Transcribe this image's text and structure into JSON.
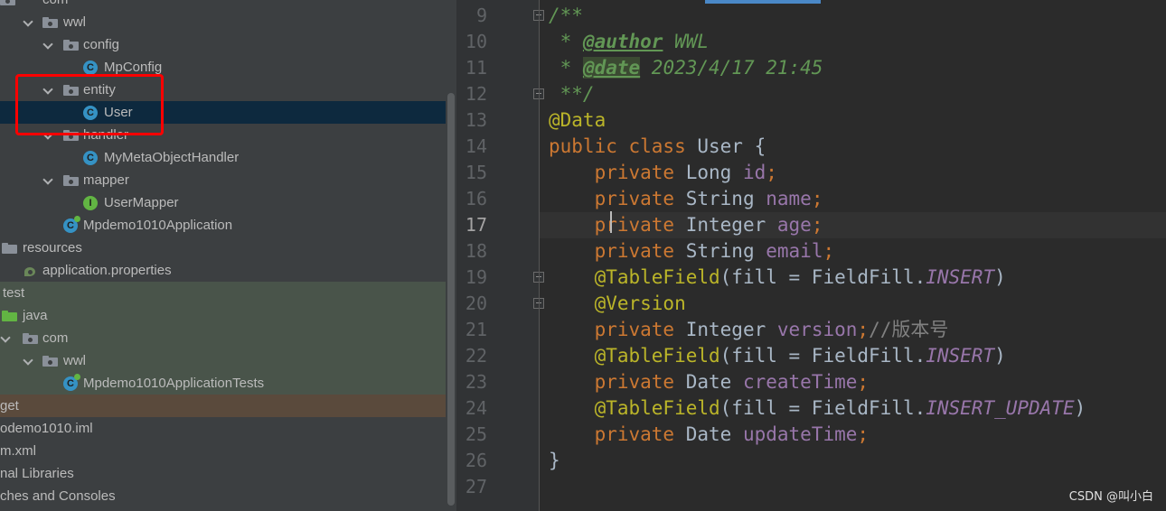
{
  "project_tree": {
    "items": [
      {
        "label": "com",
        "icon": "package-folder-icon",
        "selected": false
      },
      {
        "label": "wwl",
        "icon": "package-folder-icon"
      },
      {
        "label": "config",
        "icon": "package-folder-icon"
      },
      {
        "label": "MpConfig",
        "icon": "class-icon",
        "badge": "C"
      },
      {
        "label": "entity",
        "icon": "package-folder-icon"
      },
      {
        "label": "User",
        "icon": "class-icon",
        "badge": "C",
        "selected": true
      },
      {
        "label": "handler",
        "icon": "package-folder-icon"
      },
      {
        "label": "MyMetaObjectHandler",
        "icon": "class-icon",
        "badge": "C"
      },
      {
        "label": "mapper",
        "icon": "package-folder-icon"
      },
      {
        "label": "UserMapper",
        "icon": "interface-icon",
        "badge": "I"
      },
      {
        "label": "Mpdemo1010Application",
        "icon": "spring-app-icon",
        "badge": "C"
      },
      {
        "label": "resources",
        "icon": "resources-folder-icon"
      },
      {
        "label": "application.properties",
        "icon": "spring-properties-icon"
      },
      {
        "label": "test",
        "icon": "none"
      },
      {
        "label": "java",
        "icon": "test-folder-icon"
      },
      {
        "label": "com",
        "icon": "package-folder-icon"
      },
      {
        "label": "wwl",
        "icon": "package-folder-icon"
      },
      {
        "label": "Mpdemo1010ApplicationTests",
        "icon": "spring-app-icon",
        "badge": "C"
      },
      {
        "label": "get",
        "icon": "none"
      },
      {
        "label": "odemo1010.iml",
        "icon": "none"
      },
      {
        "label": "m.xml",
        "icon": "none"
      },
      {
        "label": "nal Libraries",
        "icon": "none"
      },
      {
        "label": "ches and Consoles",
        "icon": "none"
      }
    ]
  },
  "editor": {
    "current_line": 17,
    "lines": [
      {
        "num": "9",
        "tokens": [
          [
            "doc",
            "/**"
          ]
        ]
      },
      {
        "num": "10",
        "tokens": [
          [
            "doc",
            " * "
          ],
          [
            "doctag",
            "@author"
          ],
          [
            "doc",
            " WWL"
          ]
        ]
      },
      {
        "num": "11",
        "tokens": [
          [
            "doc",
            " * "
          ],
          [
            "docdate",
            "@date"
          ],
          [
            "doc",
            " 2023/4/17 21:45"
          ]
        ]
      },
      {
        "num": "12",
        "tokens": [
          [
            "doc",
            " **/"
          ]
        ]
      },
      {
        "num": "13",
        "tokens": [
          [
            "ann",
            "@Data"
          ]
        ]
      },
      {
        "num": "14",
        "tokens": [
          [
            "kw",
            "public class "
          ],
          [
            "plain",
            "User {"
          ]
        ]
      },
      {
        "num": "15",
        "tokens": [
          [
            "plain",
            "    "
          ],
          [
            "kw",
            "private "
          ],
          [
            "plain",
            "Long "
          ],
          [
            "field",
            "id"
          ],
          [
            "semi",
            ";"
          ]
        ]
      },
      {
        "num": "16",
        "tokens": [
          [
            "plain",
            "    "
          ],
          [
            "kw",
            "private "
          ],
          [
            "plain",
            "String "
          ],
          [
            "field",
            "name"
          ],
          [
            "semi",
            ";"
          ]
        ]
      },
      {
        "num": "17",
        "tokens": [
          [
            "plain",
            "    "
          ],
          [
            "kw",
            "private "
          ],
          [
            "plain",
            "Integer "
          ],
          [
            "field",
            "age"
          ],
          [
            "semi",
            ";"
          ]
        ]
      },
      {
        "num": "18",
        "tokens": [
          [
            "plain",
            "    "
          ],
          [
            "kw",
            "private "
          ],
          [
            "plain",
            "String "
          ],
          [
            "field",
            "email"
          ],
          [
            "semi",
            ";"
          ]
        ]
      },
      {
        "num": "19",
        "tokens": [
          [
            "plain",
            "    "
          ],
          [
            "ann",
            "@TableField"
          ],
          [
            "plain",
            "(fill = FieldFill."
          ],
          [
            "const",
            "INSERT"
          ],
          [
            "plain",
            ")"
          ]
        ]
      },
      {
        "num": "20",
        "tokens": [
          [
            "plain",
            "    "
          ],
          [
            "ann",
            "@Version"
          ]
        ]
      },
      {
        "num": "21",
        "tokens": [
          [
            "plain",
            "    "
          ],
          [
            "kw",
            "private "
          ],
          [
            "plain",
            "Integer "
          ],
          [
            "field",
            "version"
          ],
          [
            "semi",
            ";"
          ],
          [
            "comment",
            "//版本号"
          ]
        ]
      },
      {
        "num": "22",
        "tokens": [
          [
            "plain",
            "    "
          ],
          [
            "ann",
            "@TableField"
          ],
          [
            "plain",
            "(fill = FieldFill."
          ],
          [
            "const",
            "INSERT"
          ],
          [
            "plain",
            ")"
          ]
        ]
      },
      {
        "num": "23",
        "tokens": [
          [
            "plain",
            "    "
          ],
          [
            "kw",
            "private "
          ],
          [
            "plain",
            "Date "
          ],
          [
            "field",
            "createTime"
          ],
          [
            "semi",
            ";"
          ]
        ]
      },
      {
        "num": "24",
        "tokens": [
          [
            "plain",
            "    "
          ],
          [
            "ann",
            "@TableField"
          ],
          [
            "plain",
            "(fill = FieldFill."
          ],
          [
            "const",
            "INSERT_UPDATE"
          ],
          [
            "plain",
            ")"
          ]
        ]
      },
      {
        "num": "25",
        "tokens": [
          [
            "plain",
            "    "
          ],
          [
            "kw",
            "private "
          ],
          [
            "plain",
            "Date "
          ],
          [
            "field",
            "updateTime"
          ],
          [
            "semi",
            ";"
          ]
        ]
      },
      {
        "num": "26",
        "tokens": [
          [
            "plain",
            "}"
          ]
        ]
      },
      {
        "num": "27",
        "tokens": []
      }
    ]
  },
  "watermark": "CSDN @叫小白",
  "colors": {
    "tree_bg": "#3c3f41",
    "editor_bg": "#2b2b2b",
    "selection": "#0d293e",
    "highlight_box": "#ff0000",
    "keyword": "#cc7832",
    "annotation": "#bbb529",
    "field": "#9876aa",
    "doc_comment": "#629755"
  }
}
